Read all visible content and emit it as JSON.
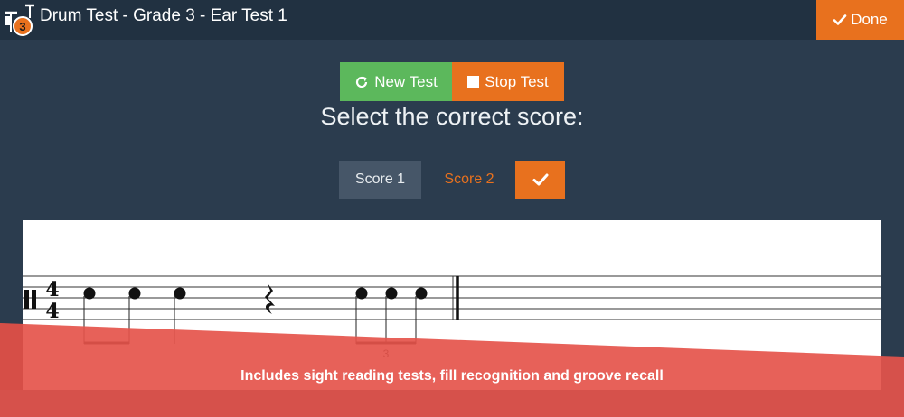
{
  "header": {
    "title": "Drum Test - Grade 3 -  Ear Test 1",
    "logo_badge": "3",
    "done_label": "Done"
  },
  "controls": {
    "new_test_label": "New Test",
    "stop_test_label": "Stop Test"
  },
  "prompt": "Select the correct score:",
  "score_options": {
    "score1_label": "Score 1",
    "score2_label": "Score 2",
    "selected": "Score 1"
  },
  "notation": {
    "time_signature": {
      "top": "4",
      "bottom": "4"
    },
    "tuplet_label": "3"
  },
  "banner": {
    "text": "Includes sight reading tests, fill recognition and groove recall"
  },
  "colors": {
    "background": "#2b3c4e",
    "topbar": "#213141",
    "accent_orange": "#e8711e",
    "new_test_green": "#5cb85c",
    "banner_red": "#e5544b",
    "selected_score": "#465668"
  },
  "icons": {
    "new_test": "refresh-icon",
    "stop_test": "stop-square-icon",
    "done": "checkmark-icon",
    "confirm": "checkmark-icon",
    "logo": "drum-kit-icon"
  }
}
